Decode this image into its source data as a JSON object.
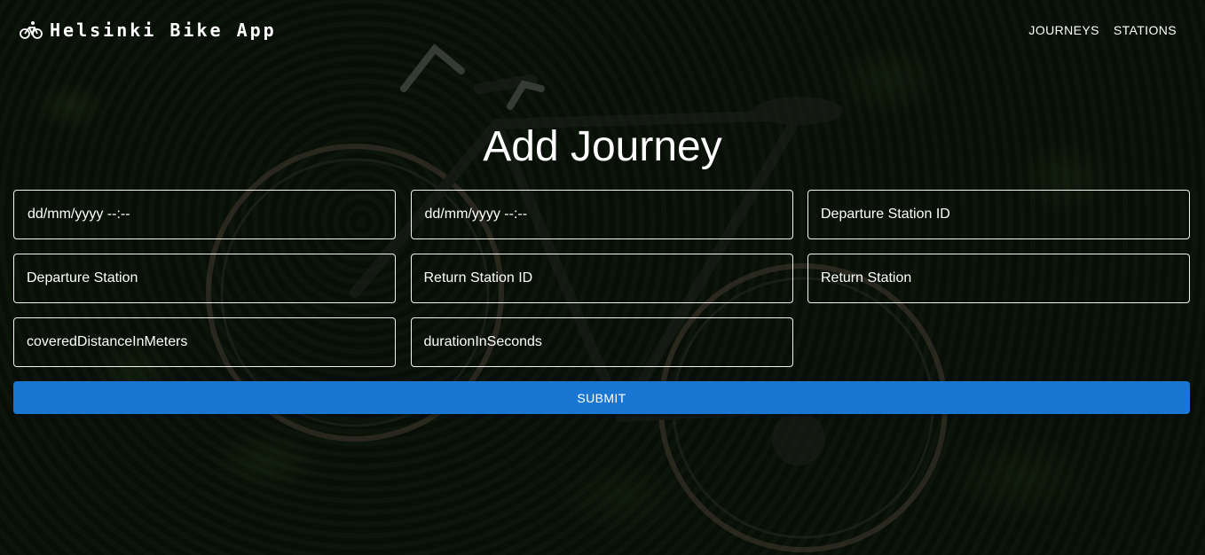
{
  "app": {
    "title": "Helsinki Bike App",
    "logo_icon": "bike-icon"
  },
  "nav": {
    "items": [
      {
        "label": "JOURNEYS"
      },
      {
        "label": "STATIONS"
      }
    ]
  },
  "main": {
    "heading": "Add Journey",
    "fields": [
      {
        "name": "departure-time",
        "placeholder": "dd/mm/yyyy --:--"
      },
      {
        "name": "return-time",
        "placeholder": "dd/mm/yyyy --:--"
      },
      {
        "name": "departure-station-id",
        "placeholder": "Departure Station ID"
      },
      {
        "name": "departure-station",
        "placeholder": "Departure Station"
      },
      {
        "name": "return-station-id",
        "placeholder": "Return Station ID"
      },
      {
        "name": "return-station",
        "placeholder": "Return Station"
      },
      {
        "name": "covered-distance",
        "placeholder": "coveredDistanceInMeters"
      },
      {
        "name": "duration",
        "placeholder": "durationInSeconds"
      }
    ],
    "submit_label": "SUBMIT"
  },
  "colors": {
    "button": "#1976d2",
    "text": "#ffffff",
    "background": "#0d160b"
  }
}
